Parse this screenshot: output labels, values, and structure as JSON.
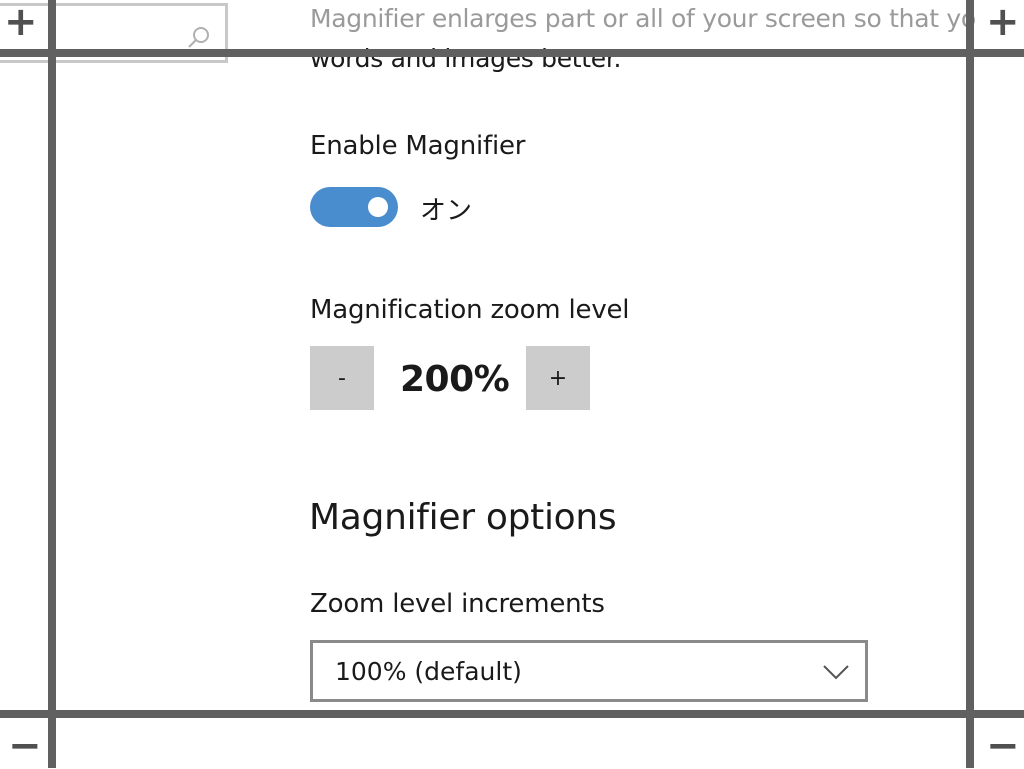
{
  "page": {
    "description_line1": "Magnifier enlarges part or all of your screen so that yo",
    "description_line2": "words and images better."
  },
  "magnifier_toggle": {
    "label": "Enable Magnifier",
    "state_text": "オン",
    "on": true
  },
  "zoom": {
    "label": "Magnification zoom level",
    "decrease_label": "-",
    "value": "200%",
    "increase_label": "+"
  },
  "options": {
    "heading": "Magnifier options",
    "increments_label": "Zoom level increments",
    "increments_value": "100% (default)"
  },
  "magnifier_frame": {
    "zoom_in_glyph": "+",
    "zoom_out_glyph": "−"
  },
  "colors": {
    "toggle_on": "#4a8dcf",
    "button_bg": "#cccccc",
    "frame": "#606060"
  },
  "icons": {
    "search": "search-icon",
    "dropdown": "chevron-down-icon"
  }
}
